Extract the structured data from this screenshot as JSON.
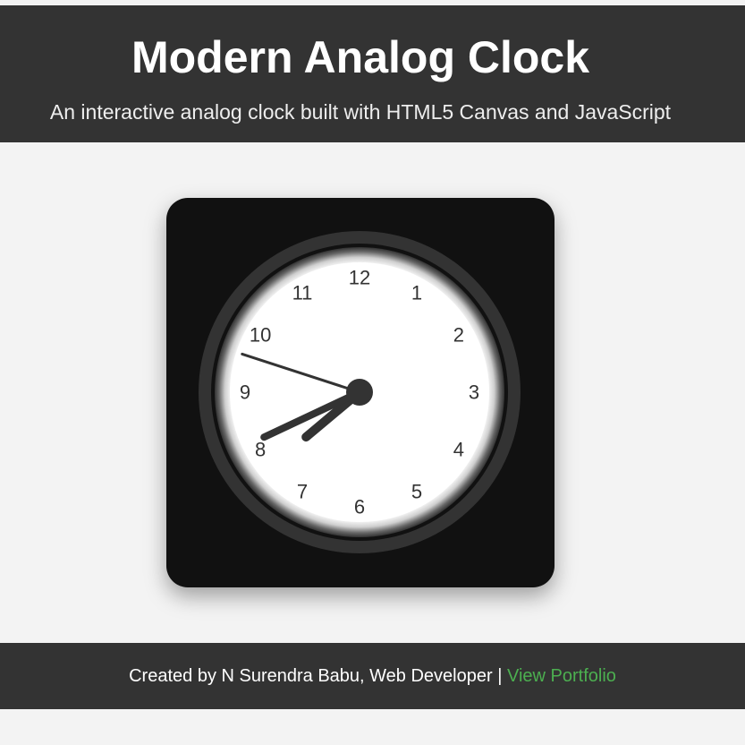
{
  "header": {
    "title": "Modern Analog Clock",
    "subtitle": "An interactive analog clock built with HTML5 Canvas and JavaScript"
  },
  "clock": {
    "numbers": [
      "12",
      "1",
      "2",
      "3",
      "4",
      "5",
      "6",
      "7",
      "8",
      "9",
      "10",
      "11"
    ],
    "time": {
      "hour": 7,
      "minute": 40,
      "second": 48
    },
    "colors": {
      "card": "#111111",
      "outer_ring": "#333333",
      "face": "#ffffff",
      "hands": "#333333"
    }
  },
  "footer": {
    "credit": "Created by N Surendra Babu, Web Developer",
    "separator": "|",
    "link_label": "View Portfolio",
    "link_color": "#4caf50"
  }
}
